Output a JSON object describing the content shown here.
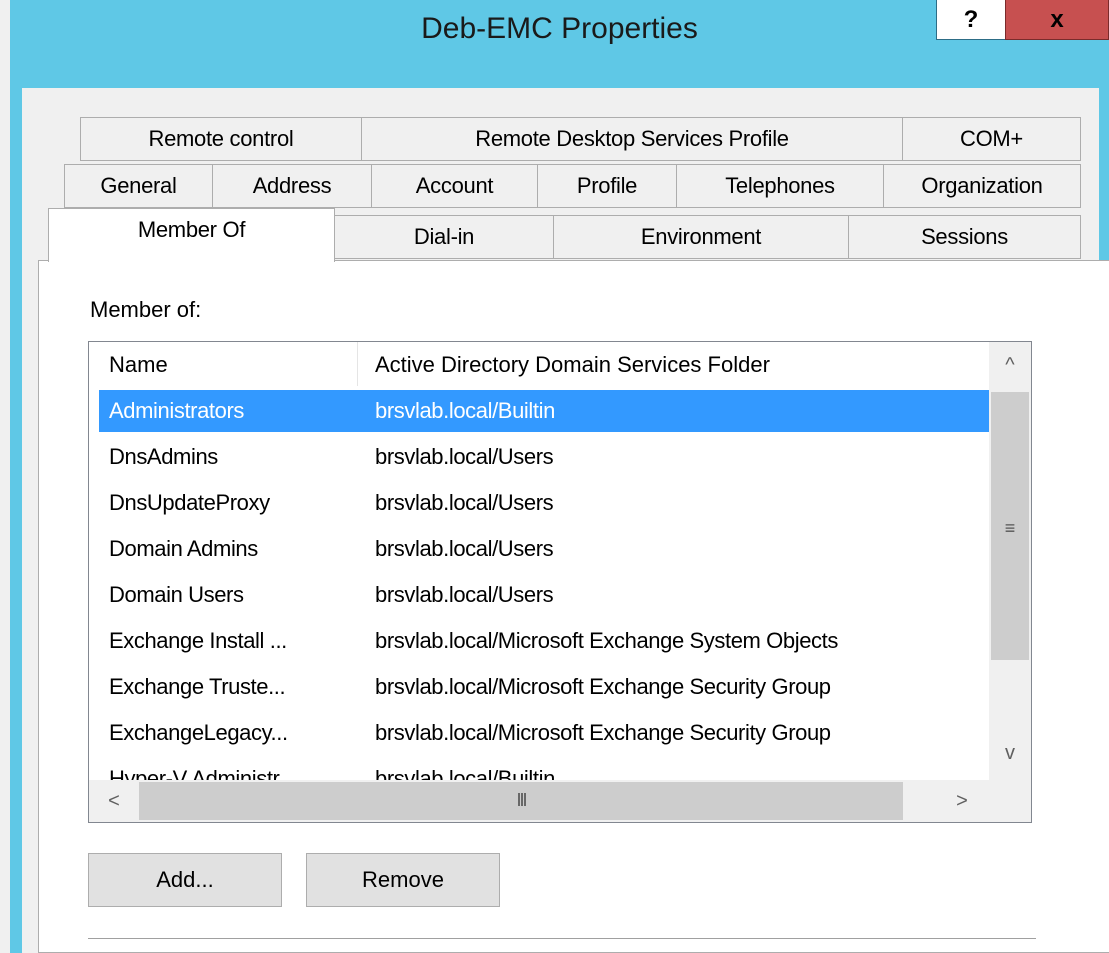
{
  "window": {
    "title": "Deb-EMC Properties",
    "help_label": "?",
    "close_label": "x",
    "title_bar_color": "#5fc8e6",
    "close_color": "#c75050"
  },
  "tabs": {
    "row1": [
      "Remote control",
      "Remote Desktop Services Profile",
      "COM+"
    ],
    "row2": [
      "General",
      "Address",
      "Account",
      "Profile",
      "Telephones",
      "Organization"
    ],
    "row3": [
      "Member Of",
      "Dial-in",
      "Environment",
      "Sessions"
    ],
    "active": "Member Of"
  },
  "member_of": {
    "label": "Member of:",
    "columns": [
      "Name",
      "Active Directory Domain Services Folder"
    ],
    "rows": [
      {
        "name": "Administrators",
        "folder": "brsvlab.local/Builtin"
      },
      {
        "name": "DnsAdmins",
        "folder": "brsvlab.local/Users"
      },
      {
        "name": "DnsUpdateProxy",
        "folder": "brsvlab.local/Users"
      },
      {
        "name": "Domain Admins",
        "folder": "brsvlab.local/Users"
      },
      {
        "name": "Domain Users",
        "folder": "brsvlab.local/Users"
      },
      {
        "name": "Exchange Install ...",
        "folder": "brsvlab.local/Microsoft Exchange System Objects"
      },
      {
        "name": "Exchange Truste...",
        "folder": "brsvlab.local/Microsoft Exchange Security Group"
      },
      {
        "name": "ExchangeLegacy...",
        "folder": "brsvlab.local/Microsoft Exchange Security Group"
      },
      {
        "name": "Hyper-V Administr...",
        "folder": "brsvlab.local/Builtin"
      }
    ],
    "selected_row": "Administrators",
    "selection_color": "#3399ff"
  },
  "scrollbars": {
    "up_arrow": "^",
    "down_arrow": "v",
    "left_arrow": "<",
    "right_arrow": ">",
    "v_grip": "≡",
    "h_grip": "III"
  },
  "buttons": {
    "add": "Add...",
    "remove": "Remove"
  }
}
